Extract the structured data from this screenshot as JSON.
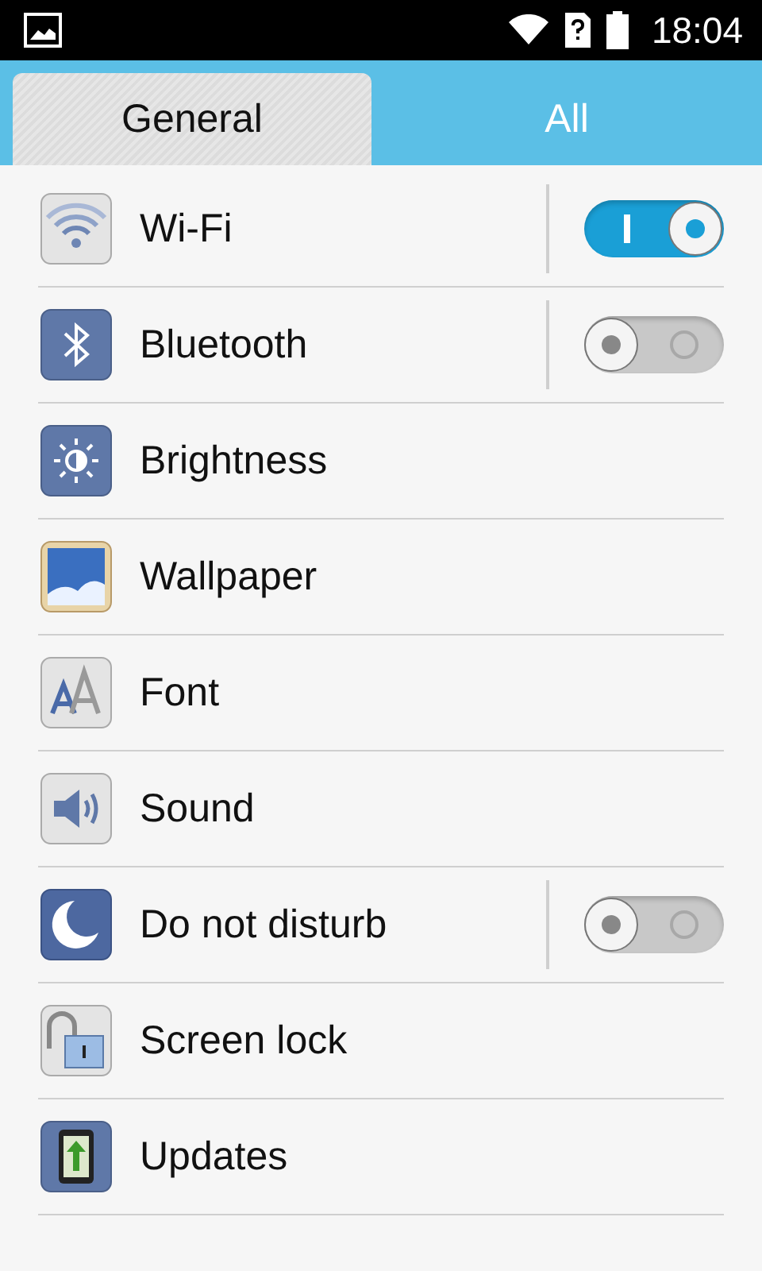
{
  "status_bar": {
    "time": "18:04"
  },
  "tabs": [
    {
      "label": "General",
      "selected": true
    },
    {
      "label": "All",
      "selected": false
    }
  ],
  "rows": [
    {
      "label": "Wi-Fi",
      "kind": "toggle",
      "on": true
    },
    {
      "label": "Bluetooth",
      "kind": "toggle",
      "on": false
    },
    {
      "label": "Brightness",
      "kind": "link"
    },
    {
      "label": "Wallpaper",
      "kind": "link"
    },
    {
      "label": "Font",
      "kind": "link"
    },
    {
      "label": "Sound",
      "kind": "link"
    },
    {
      "label": "Do not disturb",
      "kind": "toggle",
      "on": false
    },
    {
      "label": "Screen lock",
      "kind": "link"
    },
    {
      "label": "Updates",
      "kind": "link"
    }
  ]
}
